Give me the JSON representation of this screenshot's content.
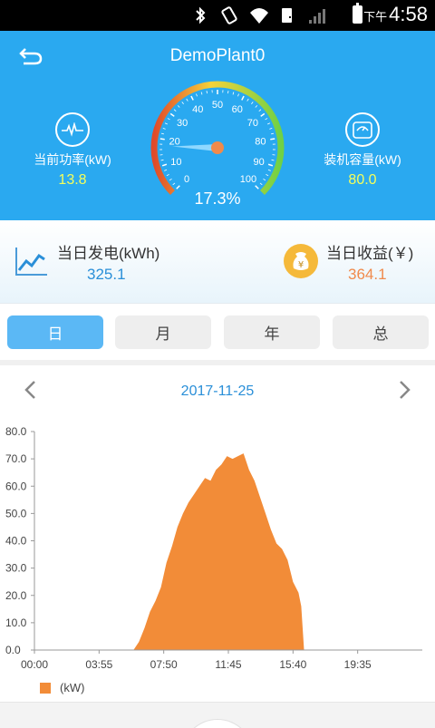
{
  "status_bar": {
    "time_prefix": "下午",
    "time": "4:58"
  },
  "header": {
    "title": "DemoPlant0",
    "current_power": {
      "label": "当前功率(kW)",
      "value": "13.8"
    },
    "capacity": {
      "label": "装机容量(kW)",
      "value": "80.0"
    },
    "gauge": {
      "ticks": [
        "0",
        "10",
        "20",
        "30",
        "40",
        "50",
        "60",
        "70",
        "80",
        "90",
        "100"
      ],
      "percent_label": "17.3%",
      "percent": 17.3
    }
  },
  "summary": {
    "generation": {
      "label": "当日发电(kWh)",
      "value": "325.1",
      "icon": "line-chart-icon"
    },
    "revenue": {
      "label": "当日收益(￥)",
      "value": "364.1",
      "icon": "money-bag-icon"
    }
  },
  "tabs": [
    {
      "label": "日",
      "active": true
    },
    {
      "label": "月",
      "active": false
    },
    {
      "label": "年",
      "active": false
    },
    {
      "label": "总",
      "active": false
    }
  ],
  "date_nav": {
    "date": "2017-11-25"
  },
  "chart_data": {
    "type": "area",
    "title": "",
    "xlabel": "",
    "ylabel": "",
    "x_tick_labels": [
      "00:00",
      "03:55",
      "07:50",
      "11:45",
      "15:40",
      "19:35"
    ],
    "y_tick_labels": [
      "0.0",
      "10.0",
      "20.0",
      "30.0",
      "40.0",
      "50.0",
      "60.0",
      "70.0",
      "80.0"
    ],
    "ylim": [
      0,
      80
    ],
    "xlim_hours": [
      0,
      23.5
    ],
    "color": "#f28c38",
    "series": [
      {
        "name": "(kW)",
        "x": [
          "00:00",
          "06:00",
          "06:20",
          "06:40",
          "07:00",
          "07:20",
          "07:40",
          "08:00",
          "08:20",
          "08:40",
          "09:00",
          "09:20",
          "09:40",
          "10:00",
          "10:20",
          "10:40",
          "11:00",
          "11:20",
          "11:40",
          "12:00",
          "12:20",
          "12:40",
          "13:00",
          "13:20",
          "13:40",
          "14:00",
          "14:20",
          "14:40",
          "15:00",
          "15:20",
          "15:40",
          "16:00",
          "16:10",
          "16:20",
          "23:30"
        ],
        "values": [
          0,
          0,
          3,
          8,
          14,
          18,
          23,
          32,
          38,
          45,
          50,
          54,
          57,
          60,
          63,
          62,
          66,
          68,
          71,
          70,
          71,
          72,
          66,
          62,
          56,
          50,
          44,
          39,
          37,
          33,
          25,
          21,
          16,
          0,
          0
        ]
      }
    ]
  },
  "legend": {
    "label": "(kW)"
  }
}
